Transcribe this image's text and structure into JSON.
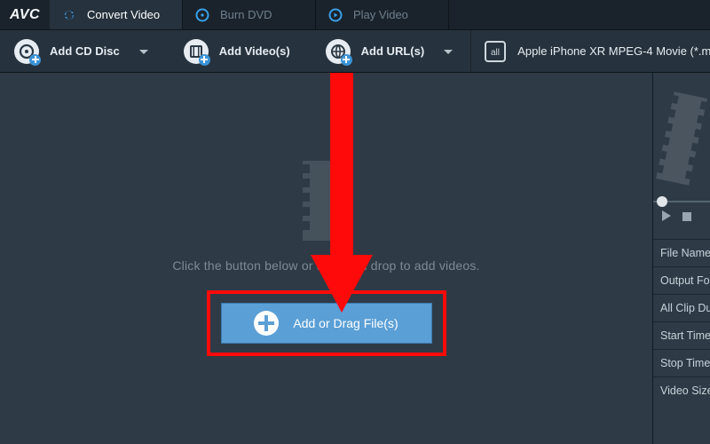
{
  "logo": "AVC",
  "tabs": [
    {
      "id": "convert",
      "label": "Convert Video",
      "active": true
    },
    {
      "id": "burn",
      "label": "Burn DVD",
      "active": false
    },
    {
      "id": "play",
      "label": "Play Video",
      "active": false
    }
  ],
  "toolbar": {
    "add_cd": "Add CD Disc",
    "add_video": "Add Video(s)",
    "add_url": "Add URL(s)"
  },
  "profile_selector": {
    "label": "Apple iPhone XR MPEG-4 Movie (*.m"
  },
  "main": {
    "hint": "Click the button below or drag and drop to add videos.",
    "add_button": "Add or Drag File(s)"
  },
  "side_meta_rows": [
    "File Name",
    "Output Fo",
    "All Clip Du",
    "Start Time",
    "Stop Time",
    "Video Size"
  ],
  "colors": {
    "annotation_red": "#ff0a0a",
    "accent_blue": "#5a9fd6"
  }
}
